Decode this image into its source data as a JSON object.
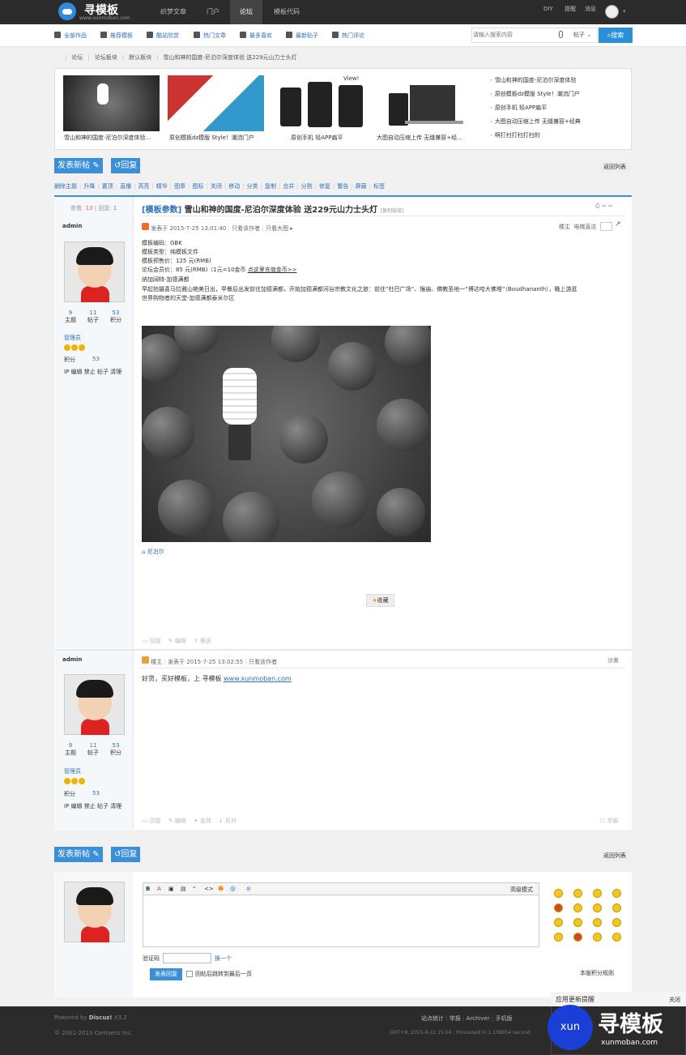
{
  "brand": {
    "name": "寻模板",
    "url": "www.xunmoban.com"
  },
  "topnav": {
    "tabs": [
      "织梦文章",
      "门户",
      "论坛",
      "模板代码"
    ],
    "active_index": 2,
    "links": [
      "DIY",
      "提醒",
      "消息"
    ]
  },
  "subnav": {
    "items": [
      "全部作品",
      "推荐模板",
      "酷站欣赏",
      "热门文章",
      "最多喜欢",
      "最新贴子",
      "热门评论"
    ]
  },
  "search": {
    "placeholder": "请输入搜索内容",
    "scope": "帖子",
    "button": "搜索"
  },
  "breadcrumb": [
    "论坛",
    "论坛板块",
    "默认板块",
    "雪山和神的国度-尼泊尔深度体验 送229元山力士头灯"
  ],
  "slider": {
    "captions": [
      "雪山和神的国度-尼泊尔深度体验...",
      "原创模板dz模版 Style！潮流门户",
      "原创手机 轻APP扁平",
      "大图自动压缩上传 无缝兼容+经..."
    ],
    "thumb_label": "View!",
    "side_links": [
      "雪山和神的国度-尼泊尔深度体验",
      "原创模板dz模版 Style！潮流门户",
      "原创手机 轻APP扁平",
      "大图自动压缩上传 无缝兼容+经典",
      "啊打扫打扫打扫的"
    ]
  },
  "buttons": {
    "new_post": "发表新帖",
    "reply": "回复",
    "back": "返回列表"
  },
  "modbar": [
    "删除主题",
    "升降",
    "置顶",
    "直播",
    "高亮",
    "精华",
    "图章",
    "图标",
    "关闭",
    "移动",
    "分类",
    "复制",
    "合并",
    "分割",
    "修复",
    "警告",
    "屏蔽",
    "标签"
  ],
  "thread": {
    "views_label": "查看:",
    "views": "13",
    "replies_label": "回复:",
    "replies": "1",
    "tag": "[模板参数]",
    "title": "雪山和神的国度-尼泊尔深度体验 送229元山力士头灯",
    "copy_link": "[复制链接]"
  },
  "post1": {
    "author": "admin",
    "stats": [
      {
        "value": "9",
        "label": "主题"
      },
      {
        "value": "11",
        "label": "帖子"
      },
      {
        "value": "53",
        "label": "积分"
      }
    ],
    "group": "管理员",
    "score_label": "积分",
    "score": "53",
    "admin_links": "IP 编辑 禁止 帖子 清理",
    "meta": "发表于 2015-7-25 13:01:40",
    "only_author": "只看该作者",
    "big_image": "只看大图",
    "floor": "楼主",
    "jump_label": "电梯直达",
    "params": [
      "模板编码：GBK",
      "模板类型：纯模板文件",
      "模板预售价：125 元(RMB)",
      "论坛会员价：85 元(RMB)（1元=10金币 "
    ],
    "recharge": "点这里充值金币>>",
    "body_title": "纳加阔特-加德满都",
    "body": "早起拍摄喜马拉雅山艳美日出，早餐后出发前往加德满都，开始加德满都河谷宗教文化之旅：前往“杜巴广场”、猴庙、佛教圣地一“博达哈大佛塔”（Boudhananth），晚上游逛世界购物者的天堂-加德满都泰米尔区",
    "tag": "尼泊尔",
    "favorite": "收藏",
    "actions": [
      "回复",
      "编辑",
      "推送"
    ]
  },
  "post2": {
    "author": "admin",
    "stats": [
      {
        "value": "9",
        "label": "主题"
      },
      {
        "value": "11",
        "label": "帖子"
      },
      {
        "value": "53",
        "label": "积分"
      }
    ],
    "group": "管理员",
    "score_label": "积分",
    "score": "53",
    "admin_links": "IP 编辑 禁止 帖子 清理",
    "badge": "楼主",
    "meta": "发表于 2015-7-25 13:02:55",
    "only_author": "只看该作者",
    "floor": "沙发",
    "body": "好货，买好模板，上 寻模板 ",
    "link": "www.xunmoban.com",
    "actions": [
      "回复",
      "编辑",
      "支持",
      "反对"
    ],
    "report": "举报"
  },
  "editor": {
    "toolbar": [
      "B",
      "A",
      "▣",
      "▤",
      "“",
      "<>",
      "☻",
      "@",
      "⊘"
    ],
    "advanced": "高级模式",
    "captcha_label": "验证码",
    "captcha_swap": "换一个",
    "submit": "发表回复",
    "checkbox_label": "回帖后跳转到最后一页",
    "rules": "本版积分规则"
  },
  "footer": {
    "powered": "Powered by ",
    "product": "Discuz!",
    "version": " X3.2",
    "copyright": "© 2001-2013 Comsenz Inc.",
    "links": [
      "站点统计",
      "举报",
      "Archiver",
      "手机版"
    ],
    "timing": "GMT+8, 2015-8-22 15:04 , Processed in 1.158954 second"
  },
  "popup": {
    "title": "应用更新提醒",
    "close": "关闭",
    "circle": "xun",
    "brand": "寻模板",
    "url": "xunmoban.com"
  },
  "colors": {
    "accent": "#3b8fd7",
    "dark": "#2b2b2b"
  }
}
